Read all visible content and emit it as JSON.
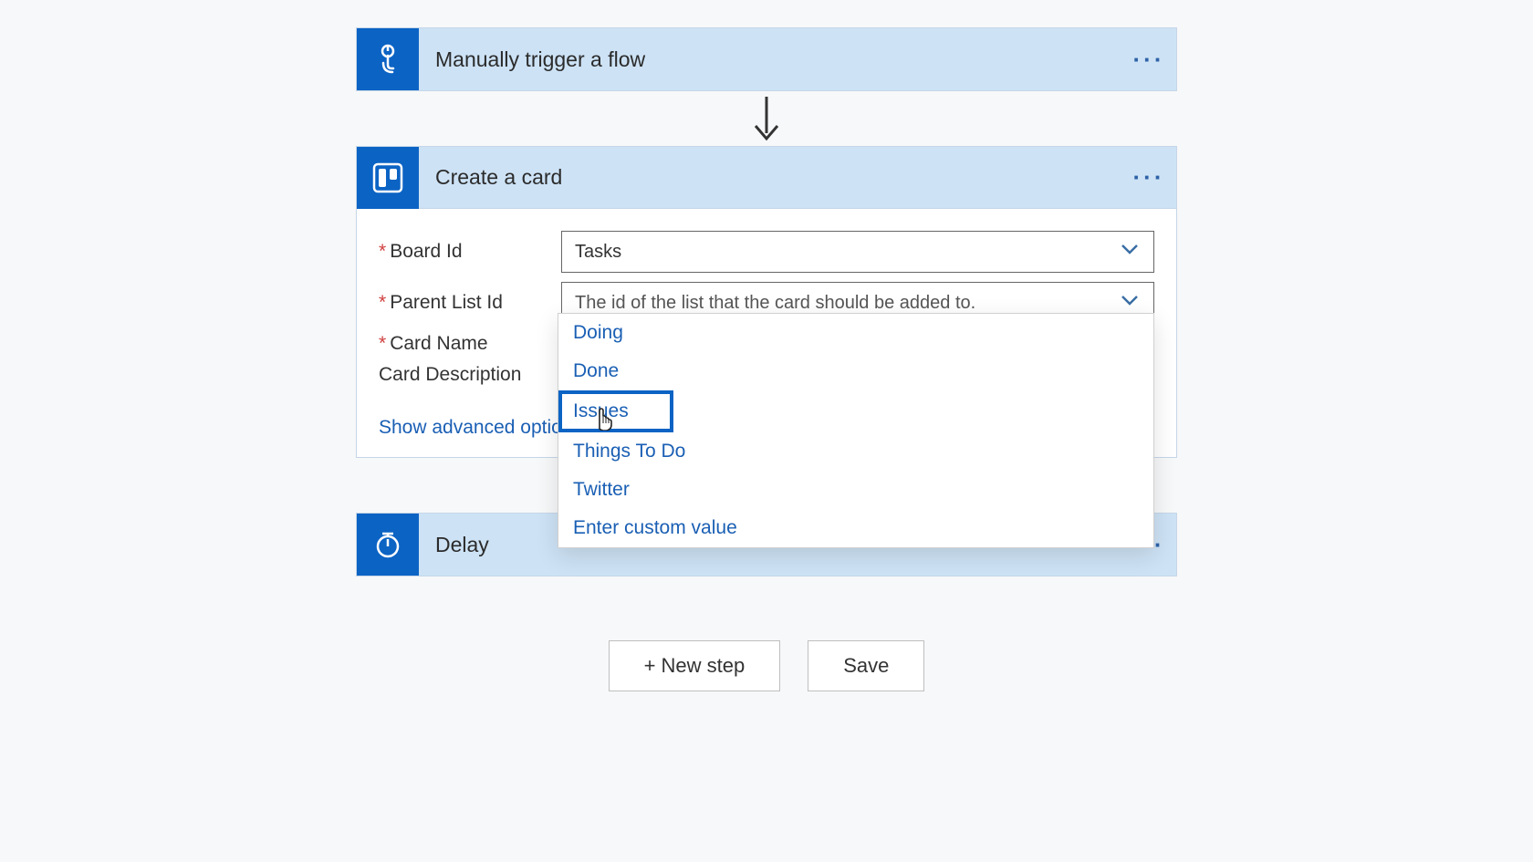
{
  "steps": {
    "trigger": {
      "title": "Manually trigger a flow"
    },
    "create_card": {
      "title": "Create a card"
    },
    "delay": {
      "title": "Delay"
    }
  },
  "fields": {
    "board_id": {
      "label": "Board Id",
      "value": "Tasks"
    },
    "parent_list_id": {
      "label": "Parent List Id",
      "placeholder": "The id of the list that the card should be added to."
    },
    "card_name": {
      "label": "Card Name"
    },
    "card_description": {
      "label": "Card Description"
    }
  },
  "advanced_link": "Show advanced options",
  "dropdown": {
    "options": [
      "Doing",
      "Done",
      "Issues",
      "Things To Do",
      "Twitter",
      "Enter custom value"
    ],
    "highlighted_index": 2
  },
  "footer": {
    "new_step": "+ New step",
    "save": "Save"
  },
  "menu_glyph": "···"
}
